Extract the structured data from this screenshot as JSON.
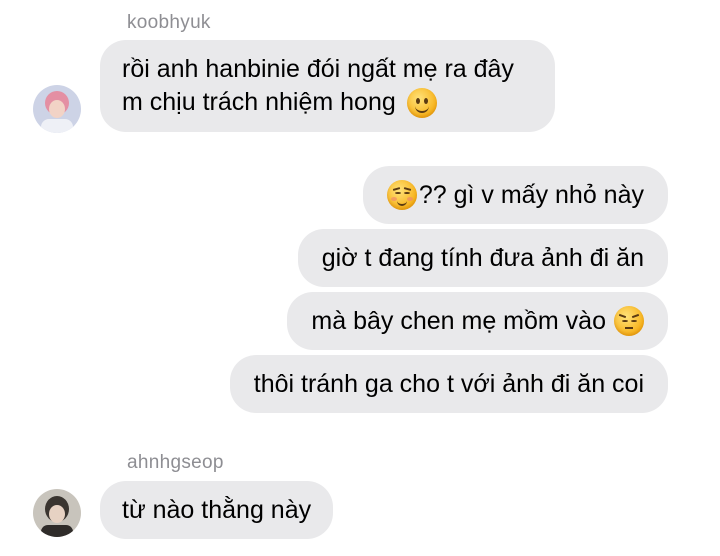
{
  "conversation": {
    "sender1": {
      "username": "koobhyuk",
      "avatar": "avatar-koobhyuk",
      "message": {
        "line1": "rồi anh hanbinie đói ngất mẹ ra đây",
        "line2": "m chịu trách nhiệm hong",
        "emoji": "slightly-smiling-face-emoji"
      }
    },
    "outgoing": [
      {
        "emoji": "relieved-face-emoji",
        "text": "?? gì v mấy nhỏ này"
      },
      {
        "text": "giờ t đang tính đưa ảnh đi ăn"
      },
      {
        "text": "mà bây chen mẹ mồm vào",
        "emoji": "pensive-face-emoji"
      },
      {
        "text": "thôi tránh ga cho t với ảnh đi ăn coi"
      }
    ],
    "sender2": {
      "username": "ahnhgseop",
      "avatar": "avatar-ahnhgseop",
      "message": {
        "text": "từ nào thằng này"
      }
    }
  },
  "colors": {
    "bubble": "#e9e9eb",
    "username": "#8e8e93",
    "text": "#000000"
  }
}
